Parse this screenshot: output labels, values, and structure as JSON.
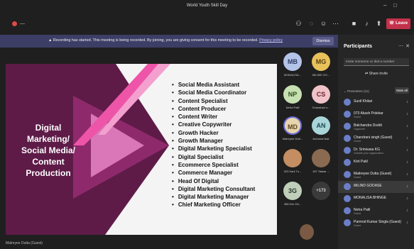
{
  "window": {
    "title": "World Youth Skill Day",
    "min_icon": "minimize-icon",
    "max_icon": "maximize-icon"
  },
  "toolbar": {
    "rec_dash": "—",
    "leave_label": "Leave",
    "icons": [
      "people-icon",
      "chat-icon",
      "reactions-icon",
      "more-icon",
      "camera-icon",
      "mic-icon",
      "share-icon"
    ]
  },
  "banner": {
    "text": "Recording has started. This meeting is being recorded. By joining, you are giving consent for this meeting to be recorded.",
    "link": "Privacy policy",
    "dismiss": "Dismiss"
  },
  "slide": {
    "title_lines": [
      "Digital",
      "Marketing/",
      "Social Media/",
      "Content",
      "Production"
    ],
    "items": [
      "Social Media Assistant",
      "Social Media Coordinator",
      "Content Specialist",
      "Content Producer",
      "Content Writer",
      "Creative Copywriter",
      "Growth Hacker",
      "Growth Manager",
      "Digital Marketing Specialist",
      "Digital Specialist",
      "Ecommerce Specialist",
      "Commerce Manager",
      "Head Of Digital",
      "Digital Marketing Consultant",
      "Digital Marketing Manager",
      "Chief Marketing Officer"
    ],
    "speaker": "Malreyee Dutta (Guest)"
  },
  "tiles": [
    {
      "initials": "MB",
      "name": "MONALISA...",
      "color": "#b3c4e8"
    },
    {
      "initials": "MG",
      "name": "MILIND GO...",
      "color": "#e8c15a"
    },
    {
      "initials": "NP",
      "name": "Netra Patil",
      "color": "#c7e0b2"
    },
    {
      "initials": "CS",
      "name": "Chandrani s...",
      "color": "#f0c3c9"
    },
    {
      "initials": "MD",
      "name": "Malreyee Dutt...",
      "color": "#e8d5ad"
    },
    {
      "initials": "AN",
      "name": "Archana Nair",
      "color": "#a9d5d9"
    },
    {
      "initials": "",
      "name": "323 Kani Tu...",
      "color": "#c48e62"
    },
    {
      "initials": "",
      "name": "187 Takkar ...",
      "color": "#8a6a50"
    },
    {
      "initials": "3G",
      "name": "368 Dev Dh...",
      "color": "#bfcfba"
    },
    {
      "initials": "+173",
      "name": "",
      "color": "#3a3a3a"
    }
  ],
  "participants": {
    "title": "Participants",
    "invite_placeholder": "Invite someone or dial a number",
    "share_invite": "Share invite",
    "presenters_label": "Presenters (11)",
    "mute_all": "Mute all",
    "people": [
      {
        "name": "Sunil Khilari",
        "status": ""
      },
      {
        "name": "073 Akash Polekar",
        "status": "Guest"
      },
      {
        "name": "Balchandra Doddi",
        "status": "Organizer"
      },
      {
        "name": "Chandrani singh (Guest)",
        "status": "Guest"
      },
      {
        "name": "Dr. Srinivasa KG",
        "status": "Outside your organization"
      },
      {
        "name": "Kirti Patil",
        "status": ""
      },
      {
        "name": "Maitreyee Dutta (Guest)",
        "status": "Guest"
      },
      {
        "name": "MILIND GODASE",
        "status": ""
      },
      {
        "name": "MONALISA BHINGE",
        "status": ""
      },
      {
        "name": "Netra Patil",
        "status": "Guest"
      },
      {
        "name": "Parmod Kumar Singla (Guest)",
        "status": "Guest"
      }
    ]
  },
  "colors": {
    "leave": "#c4314b",
    "banner": "#3d3e66",
    "slide_purple": "#5e1b48",
    "slide_pink": "#d977b8"
  }
}
